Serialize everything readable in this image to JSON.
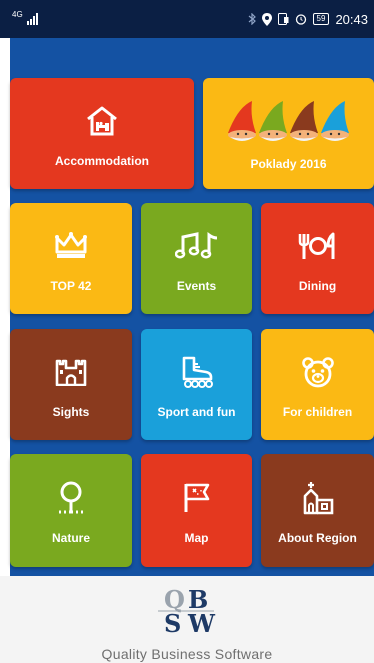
{
  "status_bar": {
    "network": "4G",
    "battery": "59",
    "time": "20:43"
  },
  "tiles": [
    {
      "label": "Accommodation",
      "icon": "house-bed-icon",
      "color": "#e4381f"
    },
    {
      "label": "Poklady 2016",
      "icon": "gnomes-icon",
      "color": "#fbb914"
    },
    {
      "label": "TOP 42",
      "icon": "crown-icon",
      "color": "#fbb914"
    },
    {
      "label": "Events",
      "icon": "music-notes-icon",
      "color": "#7aa91f"
    },
    {
      "label": "Dining",
      "icon": "cutlery-icon",
      "color": "#e4381f"
    },
    {
      "label": "Sights",
      "icon": "castle-icon",
      "color": "#8a3a1e"
    },
    {
      "label": "Sport and fun",
      "icon": "rollerskate-icon",
      "color": "#1aa0da"
    },
    {
      "label": "For children",
      "icon": "teddy-bear-icon",
      "color": "#fbb914"
    },
    {
      "label": "Nature",
      "icon": "tree-icon",
      "color": "#7aa91f"
    },
    {
      "label": "Map",
      "icon": "flag-map-icon",
      "color": "#e4381f"
    },
    {
      "label": "About Region",
      "icon": "church-icon",
      "color": "#8a3a1e"
    }
  ],
  "footer": {
    "logo_text": "QBSW",
    "tagline": "Quality Business Software"
  }
}
